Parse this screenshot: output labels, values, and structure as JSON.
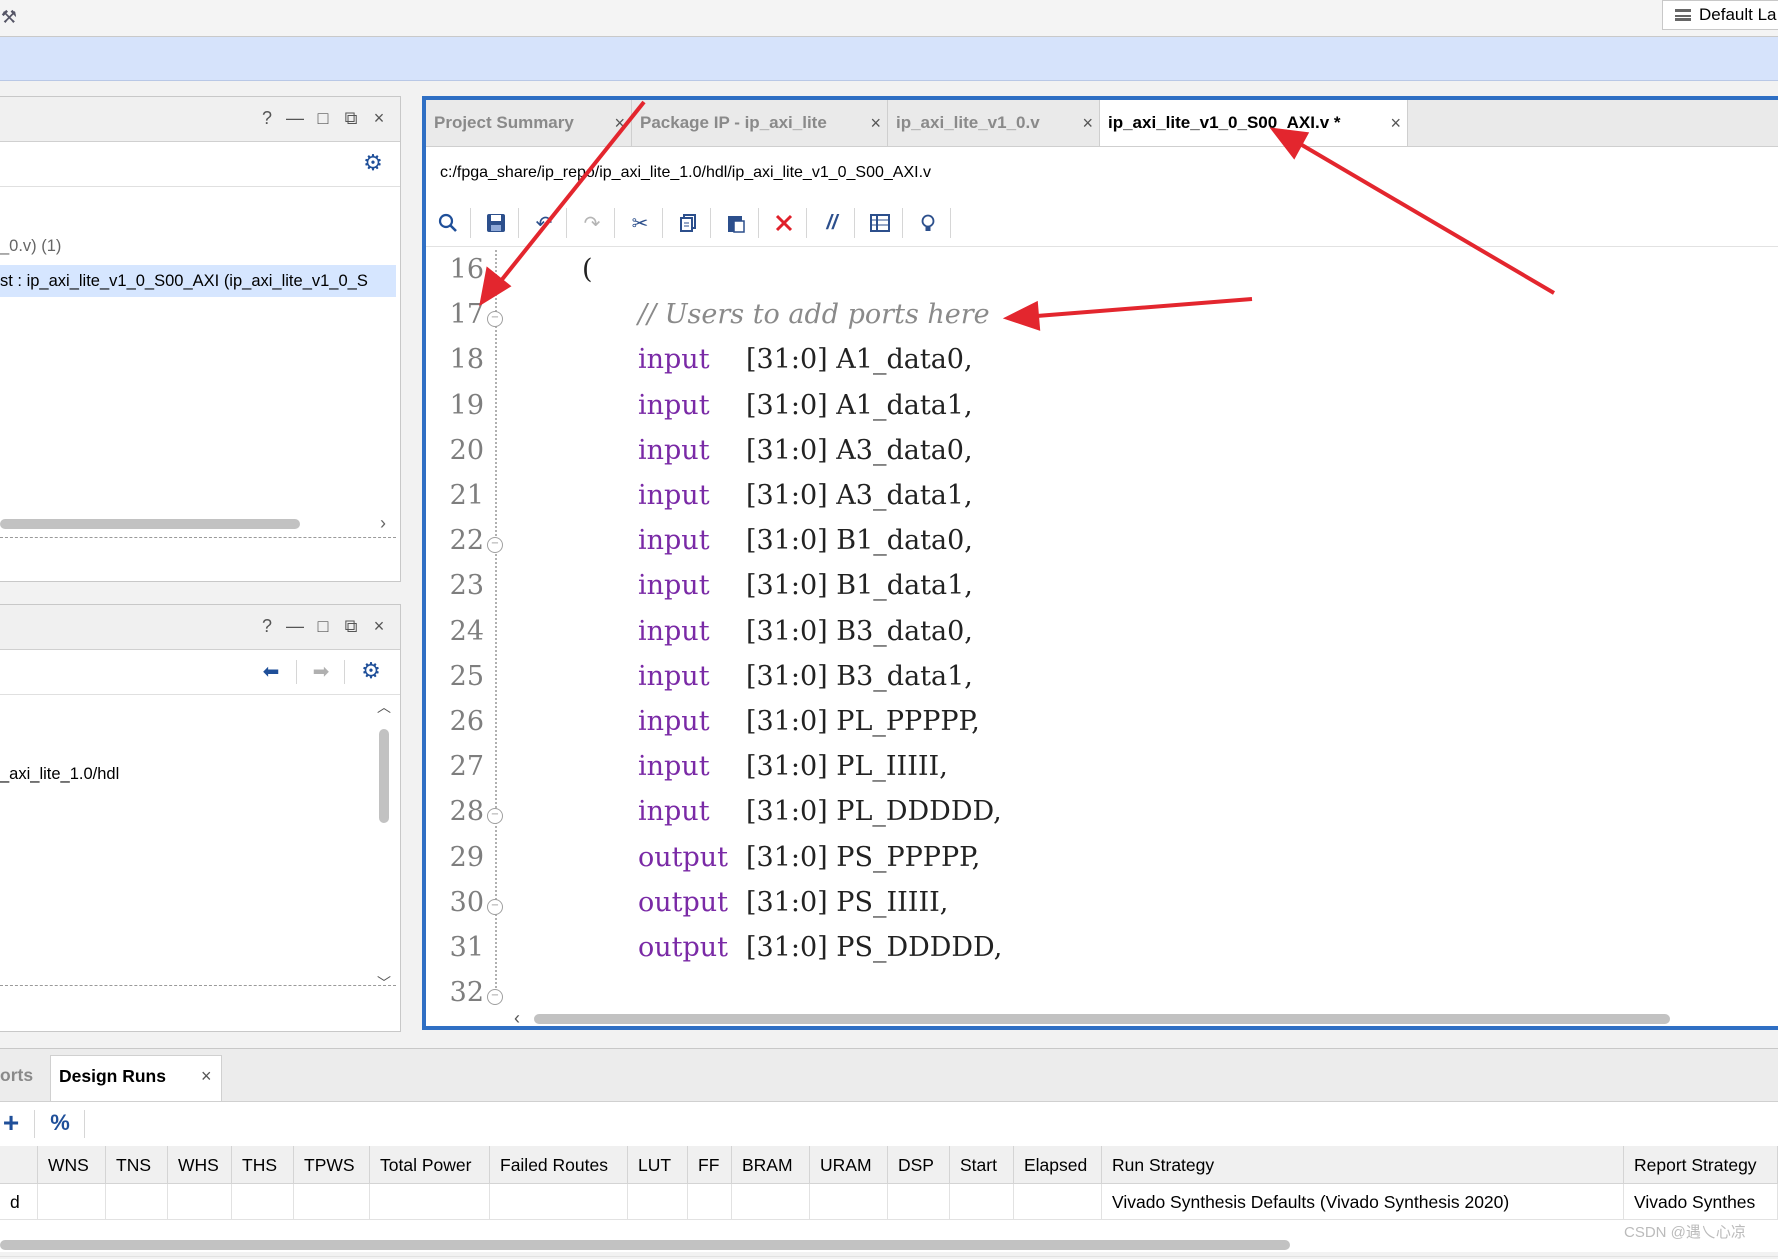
{
  "top": {
    "layout_label": "Default La"
  },
  "left_upper_panel": {
    "controls": [
      "?",
      "—",
      "□",
      "⧉",
      "×"
    ],
    "tree_items": [
      "_0.v) (1)",
      "st : ip_axi_lite_v1_0_S00_AXI (ip_axi_lite_v1_0_S"
    ]
  },
  "left_lower_panel": {
    "controls": [
      "?",
      "—",
      "□",
      "⧉",
      "×"
    ],
    "path_text": "_axi_lite_1.0/hdl"
  },
  "editor": {
    "tabs": [
      {
        "label": "Project Summary",
        "close": "×"
      },
      {
        "label": "Package IP - ip_axi_lite",
        "close": "×"
      },
      {
        "label": "ip_axi_lite_v1_0.v",
        "close": "×"
      },
      {
        "label": "ip_axi_lite_v1_0_S00_AXI.v *",
        "close": "×"
      }
    ],
    "file_path": "c:/fpga_share/ip_repo/ip_axi_lite_1.0/hdl/ip_axi_lite_v1_0_S00_AXI.v",
    "toolbar_icons": [
      "search-icon",
      "save-icon",
      "undo-icon",
      "redo-icon",
      "cut-icon",
      "copy-icon",
      "paste-icon",
      "delete-icon",
      "comment-icon",
      "block-icon",
      "lightbulb-icon"
    ],
    "code_lines": [
      {
        "num": "16",
        "kw": "",
        "rest": "(",
        "indent": "paren",
        "fold": false
      },
      {
        "num": "17",
        "kw": "",
        "rest": "",
        "comment": "// Users to add ports here",
        "fold": true
      },
      {
        "num": "18",
        "kw": "input",
        "rest": "[31:0] A1_data0,",
        "fold": false
      },
      {
        "num": "19",
        "kw": "input",
        "rest": "[31:0] A1_data1,",
        "fold": false
      },
      {
        "num": "20",
        "kw": "input",
        "rest": "[31:0] A3_data0,",
        "fold": false
      },
      {
        "num": "21",
        "kw": "input",
        "rest": "[31:0] A3_data1,",
        "fold": false
      },
      {
        "num": "22",
        "kw": "input",
        "rest": "[31:0] B1_data0,",
        "fold": true
      },
      {
        "num": "23",
        "kw": "input",
        "rest": "[31:0] B1_data1,",
        "fold": false
      },
      {
        "num": "24",
        "kw": "input",
        "rest": "[31:0] B3_data0,",
        "fold": false
      },
      {
        "num": "25",
        "kw": "input",
        "rest": "[31:0] B3_data1,",
        "fold": false
      },
      {
        "num": "26",
        "kw": "input",
        "rest": "[31:0] PL_PPPPP,",
        "fold": false
      },
      {
        "num": "27",
        "kw": "input",
        "rest": "[31:0] PL_IIIII,",
        "fold": false
      },
      {
        "num": "28",
        "kw": "input",
        "rest": "[31:0] PL_DDDDD,",
        "fold": true
      },
      {
        "num": "29",
        "kw": "output",
        "rest": "[31:0] PS_PPPPP,",
        "fold": false
      },
      {
        "num": "30",
        "kw": "output",
        "rest": "[31:0] PS_IIIII,",
        "fold": true
      },
      {
        "num": "31",
        "kw": "output",
        "rest": "[31:0] PS_DDDDD,",
        "fold": false
      },
      {
        "num": "32",
        "kw": "",
        "rest": "",
        "fold": true
      }
    ]
  },
  "bottom": {
    "tabs": [
      {
        "label": "orts"
      },
      {
        "label": "Design Runs",
        "close": "×"
      }
    ],
    "toolbar": {
      "add": "+",
      "percent": "%"
    },
    "columns": [
      "",
      "WNS",
      "TNS",
      "WHS",
      "THS",
      "TPWS",
      "Total Power",
      "Failed Routes",
      "LUT",
      "FF",
      "BRAM",
      "URAM",
      "DSP",
      "Start",
      "Elapsed",
      "Run Strategy",
      "Report Strategy"
    ],
    "rows": [
      [
        "d",
        "",
        "",
        "",
        "",
        "",
        "",
        "",
        "",
        "",
        "",
        "",
        "",
        "",
        "",
        "Vivado Synthesis Defaults (Vivado Synthesis 2020)",
        "Vivado Synthes"
      ]
    ]
  },
  "watermark": "CSDN @遇乀心凉",
  "colors": {
    "editor_border": "#2f6fc4",
    "keyword": "#7a2aa6",
    "comment": "#8a8a8a",
    "annotation_arrow": "#e3262e",
    "selection": "#d6e6ff"
  }
}
